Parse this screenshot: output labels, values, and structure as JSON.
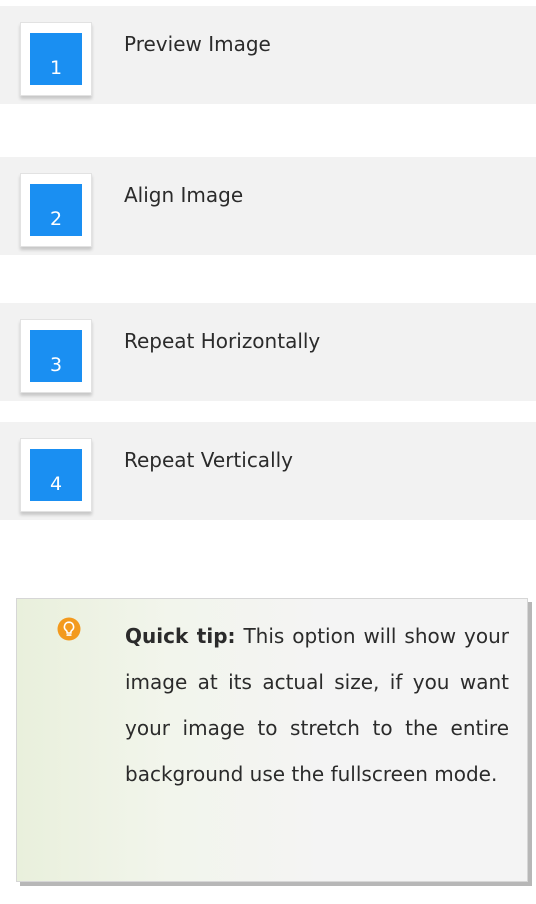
{
  "options": [
    {
      "number": "1",
      "label": "Preview Image"
    },
    {
      "number": "2",
      "label": "Align Image"
    },
    {
      "number": "3",
      "label": "Repeat Horizontally"
    },
    {
      "number": "4",
      "label": "Repeat Vertically"
    }
  ],
  "tip": {
    "icon": "lightbulb-icon",
    "heading": "Quick tip:",
    "body": "This option will show your image at its actual size, if you want your image to stretch to the entire background use the fullscreen mode."
  },
  "colors": {
    "badge": "#1a8ff2",
    "option_bg": "#f2f2f2",
    "bulb": "#f39a1e"
  }
}
